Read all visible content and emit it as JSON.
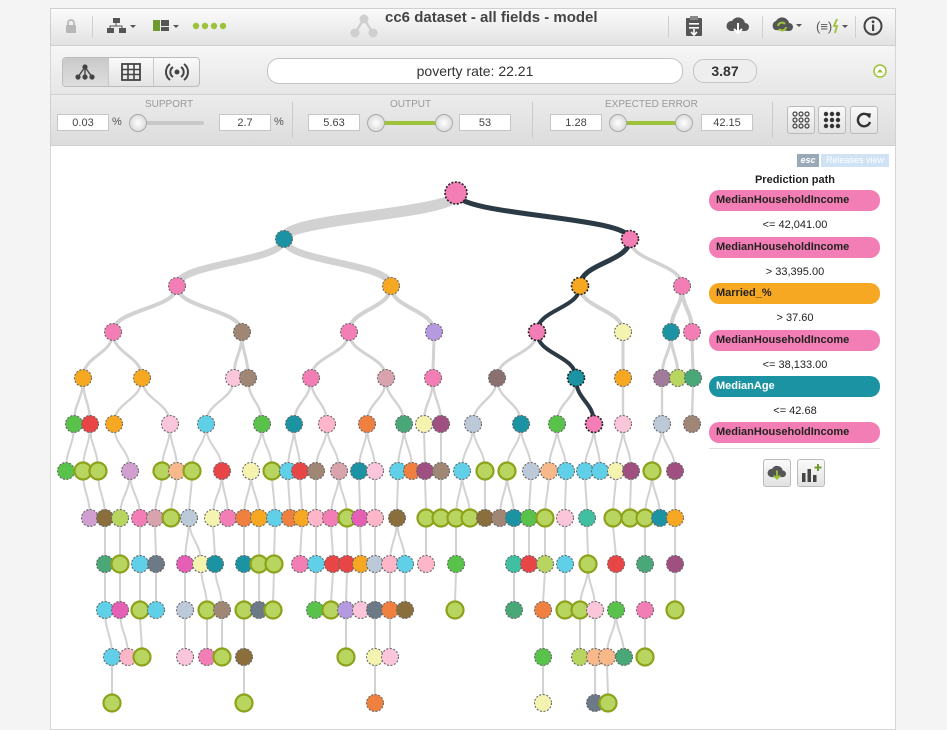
{
  "header": {
    "title": "cc6 dataset - all fields - model",
    "lock_icon": "lock-icon",
    "tree_menu_icon": "tree-structure-icon",
    "dots_count": 4
  },
  "prediction": {
    "text": "poverty rate: 22.21",
    "confidence": "3.87"
  },
  "filters": {
    "support": {
      "label": "SUPPORT",
      "min": "0.03",
      "max": "2.7",
      "unit": "%"
    },
    "output": {
      "label": "OUTPUT",
      "min": "5.63",
      "max": "53"
    },
    "expected_error": {
      "label": "EXPECTED ERROR",
      "min": "1.28",
      "max": "42.15"
    }
  },
  "legend_buttons": {
    "esc": "esc",
    "releases_view": "Releases view"
  },
  "prediction_path": {
    "title": "Prediction path",
    "steps": [
      {
        "field": "MedianHouseholdIncome",
        "color": "#f37eb5",
        "condition": "<= 42,041.00"
      },
      {
        "field": "MedianHouseholdIncome",
        "color": "#f37eb5",
        "condition": "> 33,395.00"
      },
      {
        "field": "Married_%",
        "color": "#f7a823",
        "condition": "> 37.60"
      },
      {
        "field": "MedianHouseholdIncome",
        "color": "#f37eb5",
        "condition": "<= 38,133.00"
      },
      {
        "field": "MedianAge",
        "color": "#1b93a3",
        "condition": "<= 42.68"
      },
      {
        "field": "MedianHouseholdIncome",
        "color": "#f37eb5",
        "condition": ""
      }
    ]
  },
  "colors": {
    "path": "#2b3a44",
    "branch": "#d2d2d2",
    "leaf_border": "#8ca21b"
  }
}
